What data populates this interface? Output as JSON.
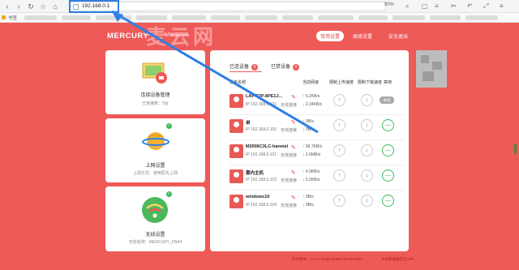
{
  "browser": {
    "address": "192.168.0.1",
    "zoom": "90%",
    "bookmark_label": "书签"
  },
  "header": {
    "logo": "MERCURY",
    "model": "MW325R",
    "watermark": "麦云网",
    "nav": [
      "常用设置",
      "高级设置",
      "安全退出"
    ]
  },
  "cards": [
    {
      "title": "连接设备管理",
      "subtitle": "已连接数：5台"
    },
    {
      "title": "上网设置",
      "subtitle": "上网方式：使用原先上网"
    },
    {
      "title": "无线设置",
      "subtitle": "无线名称：MERCURY_FBA4"
    }
  ],
  "panel": {
    "tabs": [
      {
        "label": "已连设备",
        "count": "5"
      },
      {
        "label": "已禁设备",
        "count": "0"
      }
    ],
    "columns": {
      "name": "设备名称",
      "speed": "当前网速",
      "up_limit": "限制上传速度",
      "down_limit": "限制下载速度",
      "block": "禁用"
    },
    "devices": [
      {
        "name": "LAPTOP-8PE1J...",
        "ip": "IP 192.168.0.101",
        "conn": "无线连接",
        "up": "↑ 5.2KB/s",
        "down": "↓ 2.34KB/s",
        "local": "本机"
      },
      {
        "name": "弟",
        "ip": "IP 192.168.0.100",
        "conn": "无线连接",
        "up": "↑ 0B/s",
        "down": "↓ 0B/s"
      },
      {
        "name": "M2006C3LC-hanmei",
        "ip": "IP 192.168.0.101",
        "conn": "无线连接",
        "up": "↑ 56.7KB/s",
        "down": "↓ 2.9MB/s"
      },
      {
        "name": "惠内主机",
        "ip": "IP 192.168.0.103",
        "conn": "无线连接",
        "up": "↑ 4.9KB/s",
        "down": "↓ 5.2KB/s"
      },
      {
        "name": "windows10",
        "ip": "IP 192.168.0.104",
        "conn": "无线连接",
        "up": "↑ 0B/s",
        "down": "↓ 0B/s"
      }
    ]
  },
  "footer": {
    "version": "软件版本：1.0.47 Build 150619 Rel.51363n",
    "app": "水星路由器官方APP"
  },
  "colors": {
    "brand": "#ee5a58",
    "accent": "#2f7fe6",
    "ok": "#3dbb5a"
  }
}
